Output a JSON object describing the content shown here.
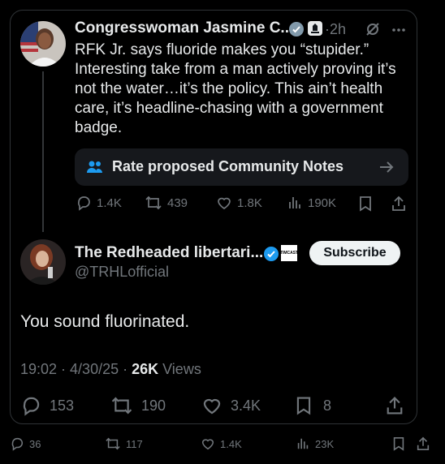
{
  "quoted_post": {
    "author_name": "Congresswoman Jasmine C...",
    "time": "2h",
    "text": "RFK Jr. says fluoride makes you “stupider.” Interesting take from a man actively proving it’s not the water…it’s the policy. This ain’t health care, it’s headline-chasing with a government badge.",
    "community_notes_label": "Rate proposed Community Notes",
    "replies": "1.4K",
    "reposts": "439",
    "likes": "1.8K",
    "views": "190K"
  },
  "reply_post": {
    "author_name": "The Redheaded libertari...",
    "handle": "@TRHLofficial",
    "badge_text": "TIMCAST",
    "subscribe_label": "Subscribe",
    "text": "You sound fluorinated.",
    "timestamp": "19:02 · 4/30/25 · ",
    "views_count": "26K",
    "views_label": " Views",
    "replies": "153",
    "reposts": "190",
    "likes": "3.4K",
    "bookmarks": "8"
  },
  "outer_post": {
    "replies": "36",
    "reposts": "117",
    "likes": "1.4K",
    "views": "23K"
  },
  "colors": {
    "accent": "#1d9bf0",
    "muted": "#71767b",
    "background": "#000000",
    "card_border": "#2f3336"
  }
}
